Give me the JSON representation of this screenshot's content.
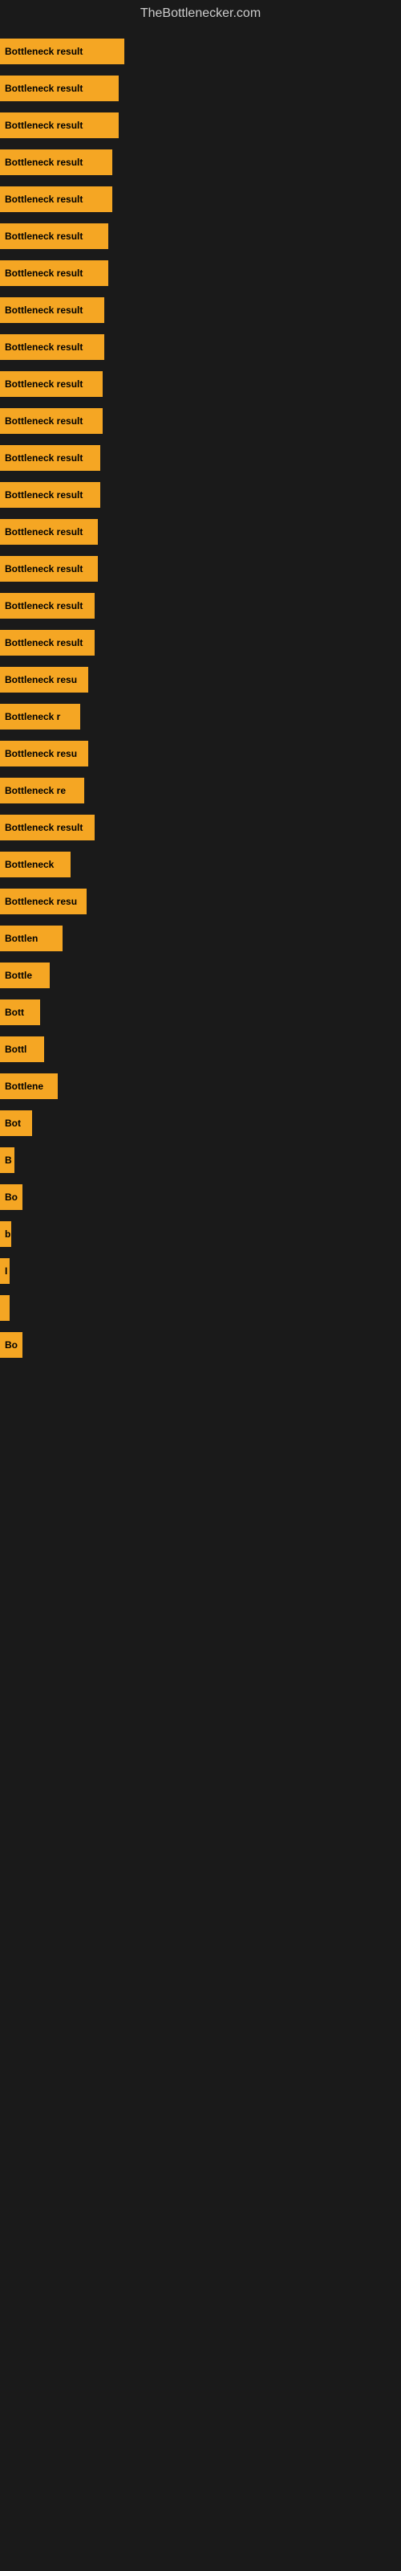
{
  "site": {
    "title": "TheBottlenecker.com"
  },
  "bars": [
    {
      "label": "Bottleneck result",
      "width": 155
    },
    {
      "label": "Bottleneck result",
      "width": 148
    },
    {
      "label": "Bottleneck result",
      "width": 148
    },
    {
      "label": "Bottleneck result",
      "width": 140
    },
    {
      "label": "Bottleneck result",
      "width": 140
    },
    {
      "label": "Bottleneck result",
      "width": 135
    },
    {
      "label": "Bottleneck result",
      "width": 135
    },
    {
      "label": "Bottleneck result",
      "width": 130
    },
    {
      "label": "Bottleneck result",
      "width": 130
    },
    {
      "label": "Bottleneck result",
      "width": 128
    },
    {
      "label": "Bottleneck result",
      "width": 128
    },
    {
      "label": "Bottleneck result",
      "width": 125
    },
    {
      "label": "Bottleneck result",
      "width": 125
    },
    {
      "label": "Bottleneck result",
      "width": 122
    },
    {
      "label": "Bottleneck result",
      "width": 122
    },
    {
      "label": "Bottleneck result",
      "width": 118
    },
    {
      "label": "Bottleneck result",
      "width": 118
    },
    {
      "label": "Bottleneck resu",
      "width": 110
    },
    {
      "label": "Bottleneck r",
      "width": 100
    },
    {
      "label": "Bottleneck resu",
      "width": 110
    },
    {
      "label": "Bottleneck re",
      "width": 105
    },
    {
      "label": "Bottleneck result",
      "width": 118
    },
    {
      "label": "Bottleneck",
      "width": 88
    },
    {
      "label": "Bottleneck resu",
      "width": 108
    },
    {
      "label": "Bottlen",
      "width": 78
    },
    {
      "label": "Bottle",
      "width": 62
    },
    {
      "label": "Bott",
      "width": 50
    },
    {
      "label": "Bottl",
      "width": 55
    },
    {
      "label": "Bottlene",
      "width": 72
    },
    {
      "label": "Bot",
      "width": 40
    },
    {
      "label": "B",
      "width": 18
    },
    {
      "label": "Bo",
      "width": 28
    },
    {
      "label": "b",
      "width": 14
    },
    {
      "label": "I",
      "width": 10
    },
    {
      "label": "",
      "width": 8
    },
    {
      "label": "Bo",
      "width": 28
    }
  ]
}
